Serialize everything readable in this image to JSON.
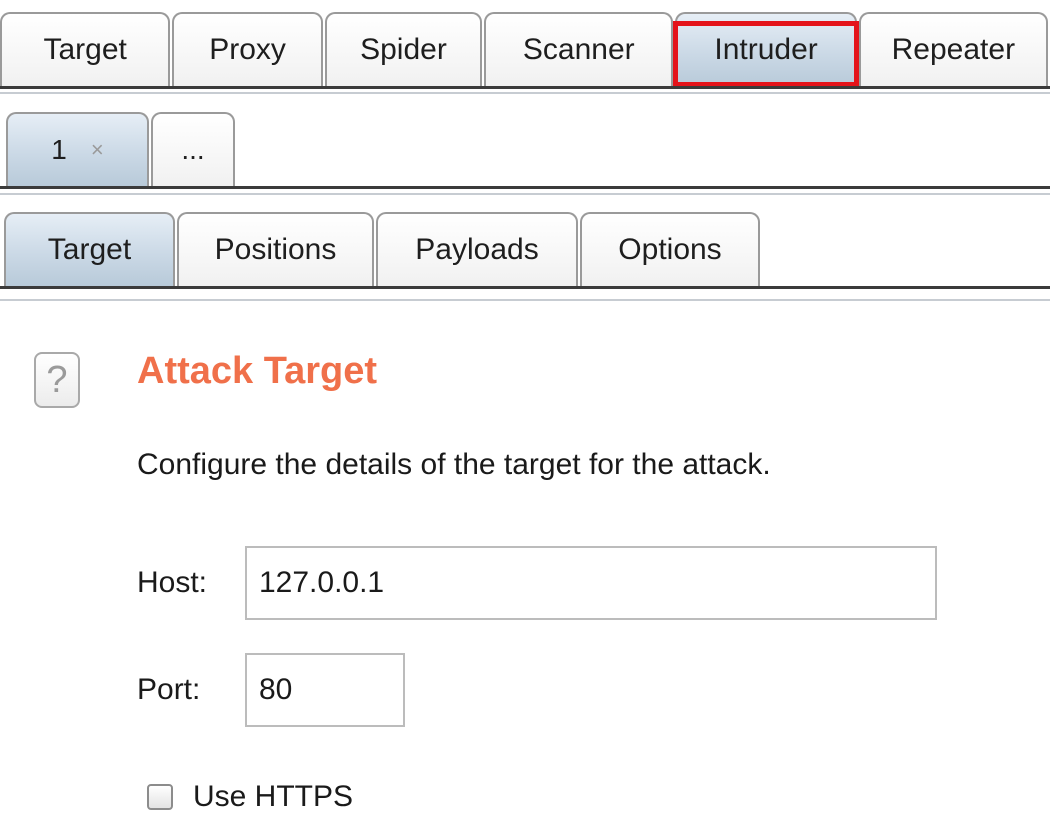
{
  "main_tabs": [
    {
      "label": "Target"
    },
    {
      "label": "Proxy"
    },
    {
      "label": "Spider"
    },
    {
      "label": "Scanner"
    },
    {
      "label": "Intruder",
      "selected": true,
      "highlighted": true
    },
    {
      "label": "Repeater"
    }
  ],
  "instance_tabs": [
    {
      "label": "1",
      "closable": true,
      "close_glyph": "×",
      "selected": true
    },
    {
      "label": "..."
    }
  ],
  "sub_tabs": [
    {
      "label": "Target",
      "selected": true
    },
    {
      "label": "Positions"
    },
    {
      "label": "Payloads"
    },
    {
      "label": "Options"
    }
  ],
  "attack_target": {
    "help_glyph": "?",
    "title": "Attack Target",
    "description": "Configure the details of the target for the attack.",
    "host_label": "Host:",
    "host_value": "127.0.0.1",
    "port_label": "Port:",
    "port_value": "80",
    "https_label": "Use HTTPS",
    "https_checked": false
  },
  "colors": {
    "title_orange": "#f0704a",
    "highlight_red": "#e4131a",
    "selected_tab_blue": "#cbd9e6"
  }
}
